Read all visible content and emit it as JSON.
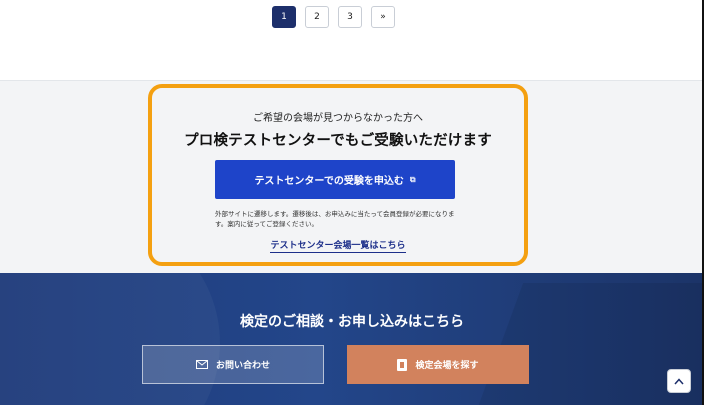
{
  "pagination": {
    "pages": [
      "1",
      "2",
      "3"
    ],
    "next": "»",
    "current": "1"
  },
  "banner": {
    "lead": "ご希望の会場が見つからなかった方へ",
    "headline": "プロ検テストセンターでもご受験いただけます",
    "cta_label": "テストセンターでの受験を申込む",
    "external_icon": "external-link-icon",
    "note": "外部サイトに遷移します。遷移後は、お申込みに当たって会員登録が必要になります。案内に従ってご登録ください。",
    "venue_list_link": "テストセンター会場一覧はこちら"
  },
  "contact": {
    "title": "検定のご相談・お申し込みはこちら",
    "inquiry_label": "お問い合わせ",
    "venue_label": "検定会場を探す",
    "inquiry_icon": "mail-icon",
    "venue_icon": "building-icon"
  },
  "scroll_top_icon": "chevron-up-icon",
  "colors": {
    "highlight": "#f4a011",
    "cta": "#1e44c9",
    "navy": "#1d2f6b",
    "venue_button": "#d2825d"
  }
}
